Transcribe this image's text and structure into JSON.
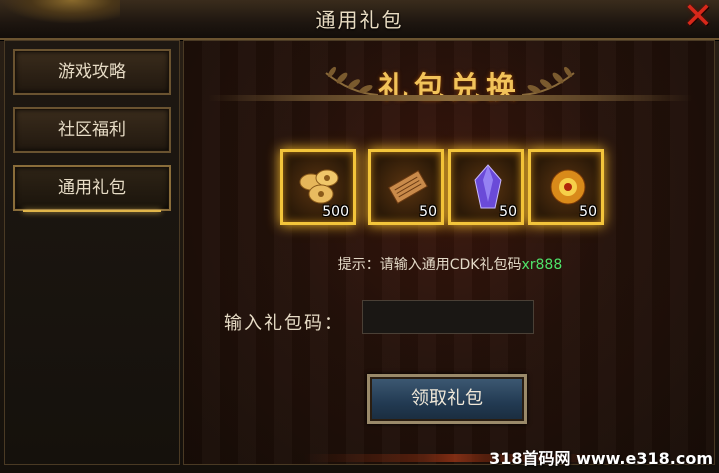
{
  "window": {
    "title": "通用礼包"
  },
  "sidebar": {
    "items": [
      {
        "label": "游戏攻略"
      },
      {
        "label": "社区福利"
      },
      {
        "label": "通用礼包"
      }
    ]
  },
  "panel": {
    "header": "礼包兑换",
    "rewards": [
      {
        "icon": "gold-coins-icon",
        "qty": "500"
      },
      {
        "icon": "scroll-icon",
        "qty": "50"
      },
      {
        "icon": "purple-crystal-icon",
        "qty": "50"
      },
      {
        "icon": "golden-orb-icon",
        "qty": "50"
      }
    ],
    "hint_prefix": "提示：请输入通用CDK礼包码",
    "hint_code": "xr888",
    "code_label": "输入礼包码：",
    "code_value": "",
    "code_placeholder": "",
    "claim_label": "领取礼包"
  },
  "watermark": "318首码网 www.e318.com",
  "colors": {
    "accent_gold": "#f3c53b",
    "hint_code": "#4fe36a",
    "close_red": "#d8281a"
  }
}
